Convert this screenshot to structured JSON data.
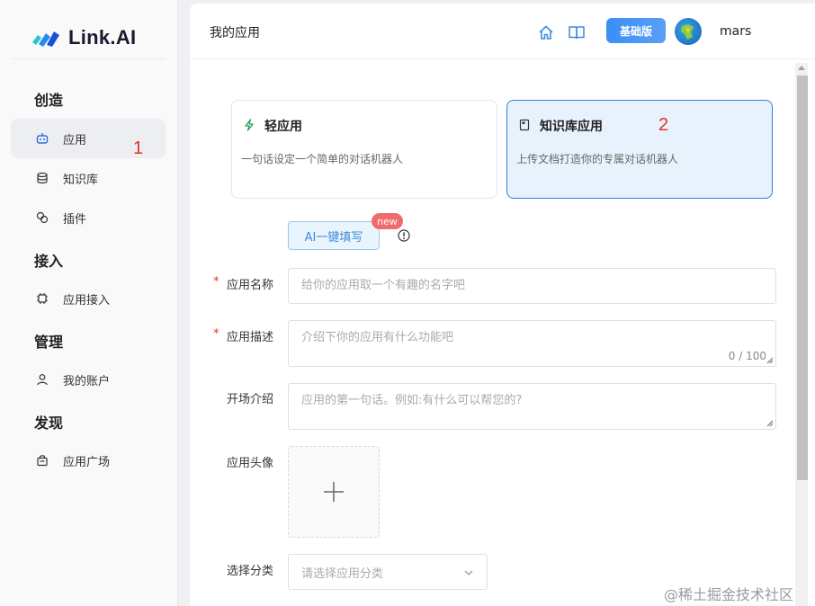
{
  "brand": {
    "name": "Link.AI"
  },
  "sidebar": {
    "sections": [
      {
        "title": "创造",
        "items": [
          {
            "label": "应用",
            "icon": "robot-icon",
            "active": true
          },
          {
            "label": "知识库",
            "icon": "database-icon"
          },
          {
            "label": "插件",
            "icon": "plugin-link-icon"
          }
        ]
      },
      {
        "title": "接入",
        "items": [
          {
            "label": "应用接入",
            "icon": "chip-icon"
          }
        ]
      },
      {
        "title": "管理",
        "items": [
          {
            "label": "我的账户",
            "icon": "user-icon"
          }
        ]
      },
      {
        "title": "发现",
        "items": [
          {
            "label": "应用广场",
            "icon": "shop-bag-icon"
          }
        ]
      }
    ]
  },
  "annotations": {
    "one": "1",
    "two": "2"
  },
  "header": {
    "title": "我的应用",
    "plan": "基础版",
    "username": "mars"
  },
  "app_types": [
    {
      "title": "轻应用",
      "desc": "一句话设定一个简单的对话机器人",
      "icon": "lightning-icon",
      "selected": false
    },
    {
      "title": "知识库应用",
      "desc": "上传文档打造你的专属对话机器人",
      "icon": "document-icon",
      "selected": true
    }
  ],
  "ai_fill": {
    "label": "AI一键填写",
    "badge": "new"
  },
  "form": {
    "name": {
      "label": "应用名称",
      "required_mark": "*",
      "placeholder": "给你的应用取一个有趣的名字吧"
    },
    "desc": {
      "label": "应用描述",
      "required_mark": "*",
      "placeholder": "介绍下你的应用有什么功能吧",
      "counter": "0 / 100"
    },
    "intro": {
      "label": "开场介绍",
      "placeholder": "应用的第一句话。例如:有什么可以帮您的?"
    },
    "avatar": {
      "label": "应用头像"
    },
    "category": {
      "label": "选择分类",
      "placeholder": "请选择应用分类"
    }
  },
  "watermark": "@稀土掘金技术社区",
  "colors": {
    "accent": "#2e7fd9",
    "required": "#e5302a",
    "badge_new": "#ef6c6c"
  }
}
